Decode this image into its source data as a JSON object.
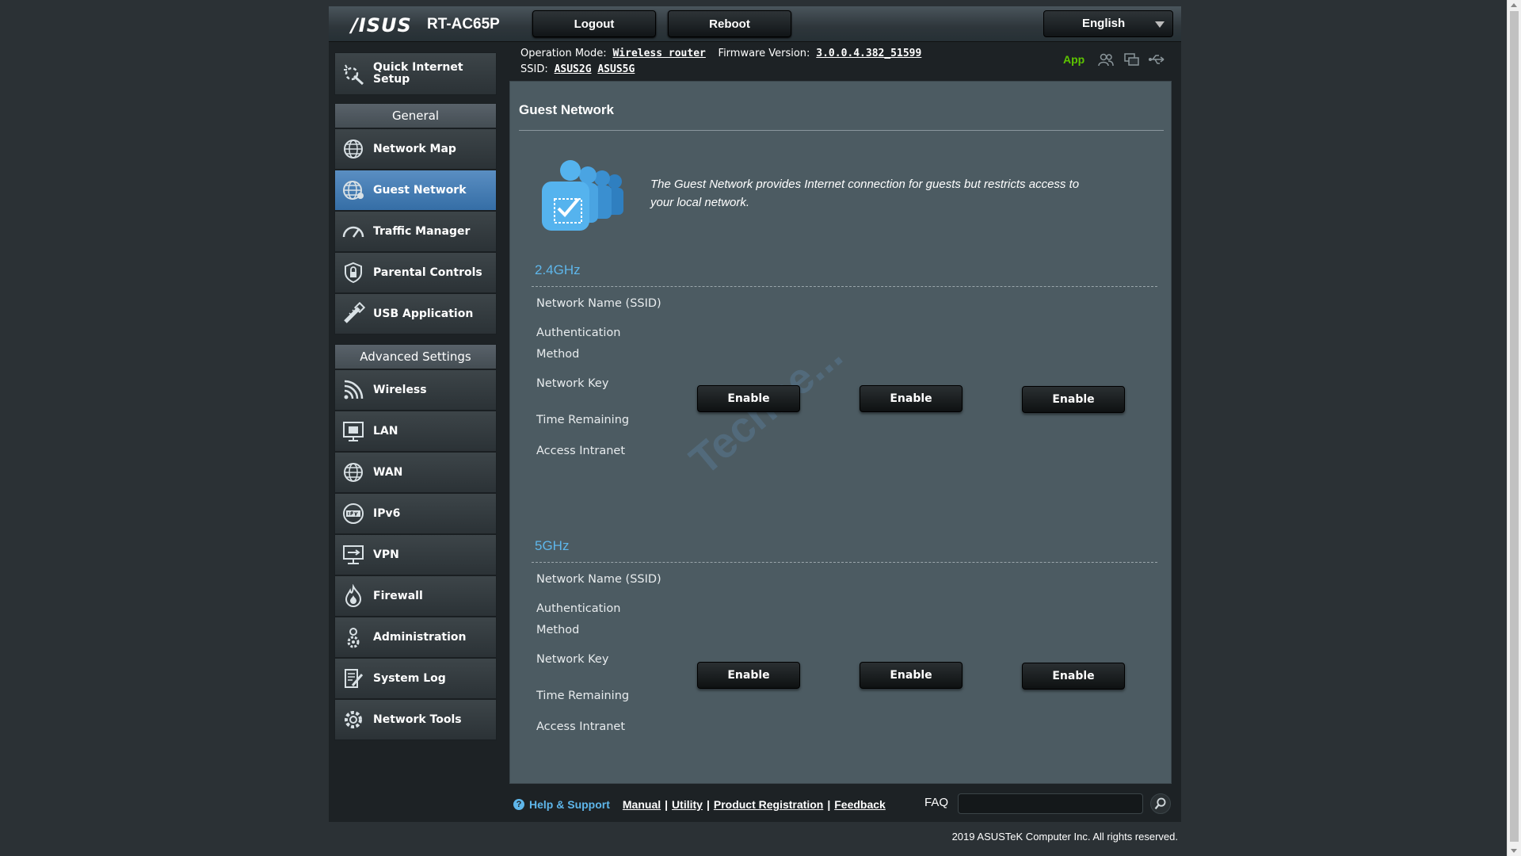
{
  "header": {
    "logo": "/ISUS",
    "model": "RT-AC65P",
    "logout_label": "Logout",
    "reboot_label": "Reboot",
    "language": "English"
  },
  "info": {
    "operation_mode_label": "Operation Mode:",
    "operation_mode_value": "Wireless router",
    "firmware_label": "Firmware Version:",
    "firmware_value": "3.0.0.4.382_51599",
    "ssid_label": "SSID:",
    "ssid_2g": "ASUS2G",
    "ssid_5g": "ASUS5G",
    "app_label": "App"
  },
  "sidebar": {
    "quick_setup": "Quick Internet Setup",
    "general_header": "General",
    "general_items": [
      {
        "label": "Network Map",
        "icon": "globe-icon"
      },
      {
        "label": "Guest Network",
        "icon": "guest-globe-icon"
      },
      {
        "label": "Traffic Manager",
        "icon": "speedometer-icon"
      },
      {
        "label": "Parental Controls",
        "icon": "lock-shield-icon"
      },
      {
        "label": "USB Application",
        "icon": "usb-icon"
      }
    ],
    "advanced_header": "Advanced Settings",
    "advanced_items": [
      {
        "label": "Wireless",
        "icon": "wifi-icon"
      },
      {
        "label": "LAN",
        "icon": "lan-icon"
      },
      {
        "label": "WAN",
        "icon": "wan-globe-icon"
      },
      {
        "label": "IPv6",
        "icon": "ipv6-icon"
      },
      {
        "label": "VPN",
        "icon": "vpn-icon"
      },
      {
        "label": "Firewall",
        "icon": "fire-icon"
      },
      {
        "label": "Administration",
        "icon": "admin-gear-icon"
      },
      {
        "label": "System Log",
        "icon": "log-icon"
      },
      {
        "label": "Network Tools",
        "icon": "tools-gear-icon"
      }
    ]
  },
  "content": {
    "title": "Guest Network",
    "description": "The Guest Network provides Internet connection for guests but restricts access to your local network.",
    "watermark": "Techne...",
    "bands": [
      {
        "name": "2.4GHz",
        "labels": {
          "ssid": "Network Name (SSID)",
          "auth1": "Authentication",
          "auth2": "Method",
          "key": "Network Key",
          "time": "Time Remaining",
          "intranet": "Access Intranet"
        },
        "buttons": [
          "Enable",
          "Enable",
          "Enable"
        ]
      },
      {
        "name": "5GHz",
        "labels": {
          "ssid": "Network Name (SSID)",
          "auth1": "Authentication",
          "auth2": "Method",
          "key": "Network Key",
          "time": "Time Remaining",
          "intranet": "Access Intranet"
        },
        "buttons": [
          "Enable",
          "Enable",
          "Enable"
        ]
      }
    ]
  },
  "footer": {
    "help": "Help & Support",
    "links": [
      "Manual",
      "Utility",
      "Product Registration",
      "Feedback"
    ],
    "faq": "FAQ",
    "copyright": "2019 ASUSTeK Computer Inc. All rights reserved."
  },
  "colors": {
    "accent_blue": "#5eb6ea",
    "app_green": "#5dc400",
    "active_item": "#4a80b8"
  }
}
